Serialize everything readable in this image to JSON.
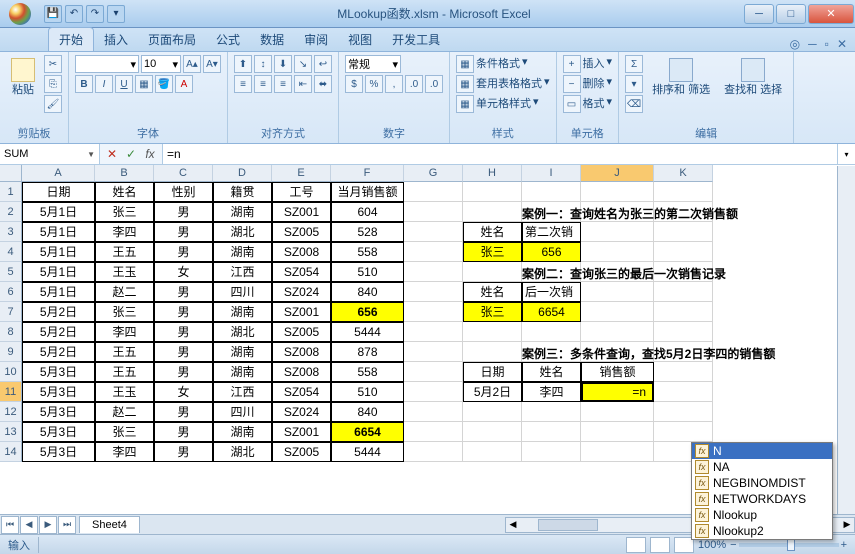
{
  "title": "MLookup函数.xlsm - Microsoft Excel",
  "tabs": [
    "开始",
    "插入",
    "页面布局",
    "公式",
    "数据",
    "审阅",
    "视图",
    "开发工具"
  ],
  "active_tab": 0,
  "ribbon_groups": {
    "clipboard": {
      "label": "剪贴板",
      "paste": "粘贴"
    },
    "font": {
      "label": "字体",
      "font_name": "",
      "font_size": "10",
      "bold": "B",
      "italic": "I",
      "underline": "U"
    },
    "align": {
      "label": "对齐方式"
    },
    "number": {
      "label": "数字",
      "format": "常规",
      "pct": "%"
    },
    "styles": {
      "label": "样式",
      "cond": "条件格式",
      "table": "套用表格格式",
      "cell": "单元格样式"
    },
    "cells": {
      "label": "单元格",
      "insert": "插入",
      "delete": "删除",
      "format": "格式"
    },
    "editing": {
      "label": "编辑",
      "sigma": "Σ",
      "sortfilter": "排序和\n筛选",
      "findsel": "查找和\n选择"
    }
  },
  "namebox": "SUM",
  "formula": "=n",
  "columns": [
    "A",
    "B",
    "C",
    "D",
    "E",
    "F",
    "G",
    "H",
    "I",
    "J",
    "K"
  ],
  "row_numbers": [
    1,
    2,
    3,
    4,
    5,
    6,
    7,
    8,
    9,
    10,
    11,
    12,
    13,
    14
  ],
  "wide_cols": [
    0,
    5,
    9
  ],
  "active_row": 11,
  "active_col": "J",
  "sheet_tab": "Sheet4",
  "status_text": "输入",
  "zoom": "100%",
  "main_table_header": [
    "日期",
    "姓名",
    "性别",
    "籍贯",
    "工号",
    "当月销售额"
  ],
  "main_table_rows": [
    [
      "5月1日",
      "张三",
      "男",
      "湖南",
      "SZ001",
      "604"
    ],
    [
      "5月1日",
      "李四",
      "男",
      "湖北",
      "SZ005",
      "528"
    ],
    [
      "5月1日",
      "王五",
      "男",
      "湖南",
      "SZ008",
      "558"
    ],
    [
      "5月1日",
      "王玉",
      "女",
      "江西",
      "SZ054",
      "510"
    ],
    [
      "5月1日",
      "赵二",
      "男",
      "四川",
      "SZ024",
      "840"
    ],
    [
      "5月2日",
      "张三",
      "男",
      "湖南",
      "SZ001",
      "656"
    ],
    [
      "5月2日",
      "李四",
      "男",
      "湖北",
      "SZ005",
      "5444"
    ],
    [
      "5月2日",
      "王五",
      "男",
      "湖南",
      "SZ008",
      "878"
    ],
    [
      "5月3日",
      "王五",
      "男",
      "湖南",
      "SZ008",
      "558"
    ],
    [
      "5月3日",
      "王玉",
      "女",
      "江西",
      "SZ054",
      "510"
    ],
    [
      "5月3日",
      "赵二",
      "男",
      "四川",
      "SZ024",
      "840"
    ],
    [
      "5月3日",
      "张三",
      "男",
      "湖南",
      "SZ001",
      "6654"
    ],
    [
      "5月3日",
      "李四",
      "男",
      "湖北",
      "SZ005",
      "5444"
    ]
  ],
  "highlight_rows": {
    "6": true,
    "12": true
  },
  "case1": {
    "title": "案例一：查询姓名为张三的第二次销售额",
    "h1": "姓名",
    "h2": "第二次销售额",
    "v1": "张三",
    "v2": "656"
  },
  "case2": {
    "title": "案例二：查询张三的最后一次销售记录",
    "h1": "姓名",
    "h2": "后一次销售记录",
    "v1": "张三",
    "v2": "6654"
  },
  "case3": {
    "title": "案例三：多条件查询，查找5月2日李四的销售额",
    "h1": "日期",
    "h2": "姓名",
    "h3": "销售额",
    "v1": "5月2日",
    "v2": "李四",
    "v3": "=n"
  },
  "autocomplete": [
    "N",
    "NA",
    "NEGBINOMDIST",
    "NETWORKDAYS",
    "Nlookup",
    "Nlookup2"
  ],
  "autocomplete_sel": 0
}
